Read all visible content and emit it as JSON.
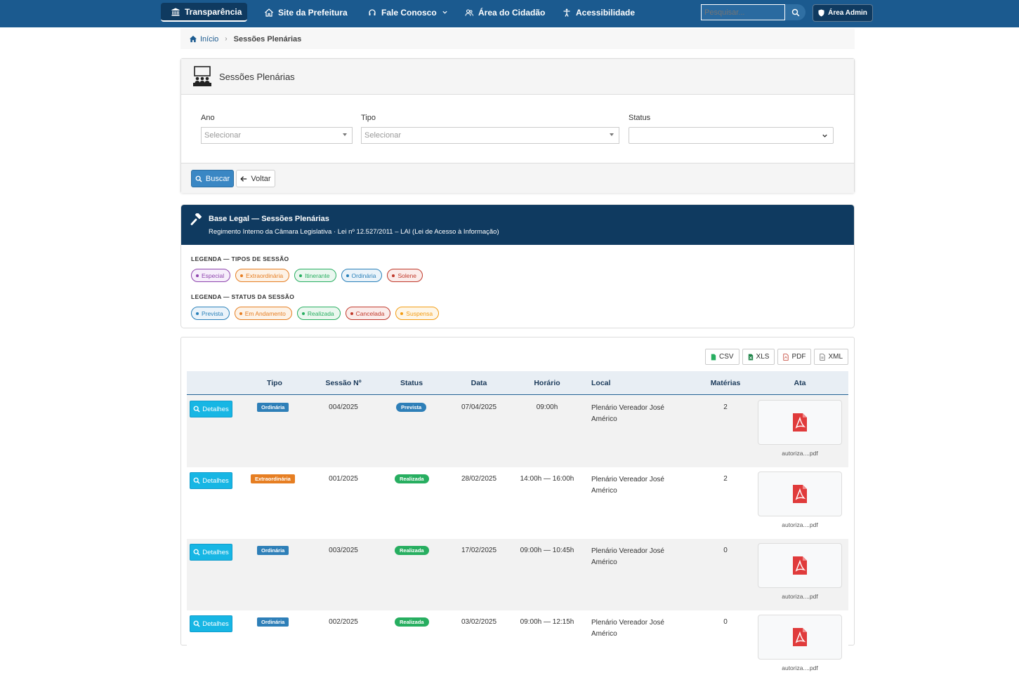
{
  "nav": {
    "items": [
      {
        "label": "Transparência",
        "icon": "bank-icon",
        "active": true
      },
      {
        "label": "Site da Prefeitura",
        "icon": "home-icon",
        "active": false
      },
      {
        "label": "Fale Conosco",
        "icon": "headset-icon",
        "active": false
      },
      {
        "label": "Área do Cidadão",
        "icon": "users-icon",
        "active": false
      },
      {
        "label": "Acessibilidade",
        "icon": "accessibility-icon",
        "active": false
      }
    ],
    "search_placeholder": "Pesquisar...",
    "admin_label": "Área Admin"
  },
  "breadcrumb": {
    "home": "Início",
    "current": "Sessões Plenárias"
  },
  "filter": {
    "title": "Sessões Plenárias",
    "ano_label": "Ano",
    "ano_placeholder": "Selecionar",
    "tipo_label": "Tipo",
    "tipo_placeholder": "Selecionar",
    "status_label": "Status",
    "status_value": "",
    "buscar_label": "Buscar",
    "voltar_label": "Voltar"
  },
  "legal": {
    "title": "Base Legal — Sessões Plenárias",
    "subtitle": "Regimento Interno da Câmara Legislativa  ·  Lei nº 12.527/2011 – LAI (Lei de Acesso à Informação)",
    "tipos_title": "LEGENDA — TIPOS DE SESSÃO",
    "tipos": [
      {
        "label": "Especial",
        "color": "#8e44ad"
      },
      {
        "label": "Extraordinária",
        "color": "#e67e22"
      },
      {
        "label": "Itinerante",
        "color": "#27ae60"
      },
      {
        "label": "Ordinária",
        "color": "#2980b9"
      },
      {
        "label": "Solene",
        "color": "#c0392b"
      }
    ],
    "status_title": "LEGENDA — STATUS DA SESSÃO",
    "status": [
      {
        "label": "Prevista",
        "color": "#2980b9"
      },
      {
        "label": "Em Andamento",
        "color": "#e67e22"
      },
      {
        "label": "Realizada",
        "color": "#27ae60"
      },
      {
        "label": "Cancelada",
        "color": "#c0392b"
      },
      {
        "label": "Suspensa",
        "color": "#f39c12"
      }
    ]
  },
  "export": [
    "CSV",
    "XLS",
    "PDF",
    "XML"
  ],
  "table": {
    "headers": [
      "Tipo",
      "Sessão Nº",
      "Status",
      "Data",
      "Horário",
      "Local",
      "Matérias",
      "Ata"
    ],
    "details_label": "Detalhes",
    "rows": [
      {
        "tipo": "Ordinária",
        "tipo_color": "#2e7fb8",
        "sessao": "004/2025",
        "status": "Prevista",
        "status_color": "#2e7fb8",
        "data": "07/04/2025",
        "horario": "09:00h",
        "local": "Plenário Vereador José Américo",
        "materias": "2",
        "ata": "autoriza....pdf"
      },
      {
        "tipo": "Extraordinária",
        "tipo_color": "#e67e22",
        "sessao": "001/2025",
        "status": "Realizada",
        "status_color": "#27ae60",
        "data": "28/02/2025",
        "horario": "14:00h — 16:00h",
        "local": "Plenário Vereador José Américo",
        "materias": "2",
        "ata": "autoriza....pdf"
      },
      {
        "tipo": "Ordinária",
        "tipo_color": "#2e7fb8",
        "sessao": "003/2025",
        "status": "Realizada",
        "status_color": "#27ae60",
        "data": "17/02/2025",
        "horario": "09:00h — 10:45h",
        "local": "Plenário Vereador José Américo",
        "materias": "0",
        "ata": "autoriza....pdf"
      },
      {
        "tipo": "Ordinária",
        "tipo_color": "#2e7fb8",
        "sessao": "002/2025",
        "status": "Realizada",
        "status_color": "#27ae60",
        "data": "03/02/2025",
        "horario": "09:00h — 12:15h",
        "local": "Plenário Vereador José Américo",
        "materias": "0",
        "ata": "autoriza....pdf"
      }
    ]
  }
}
